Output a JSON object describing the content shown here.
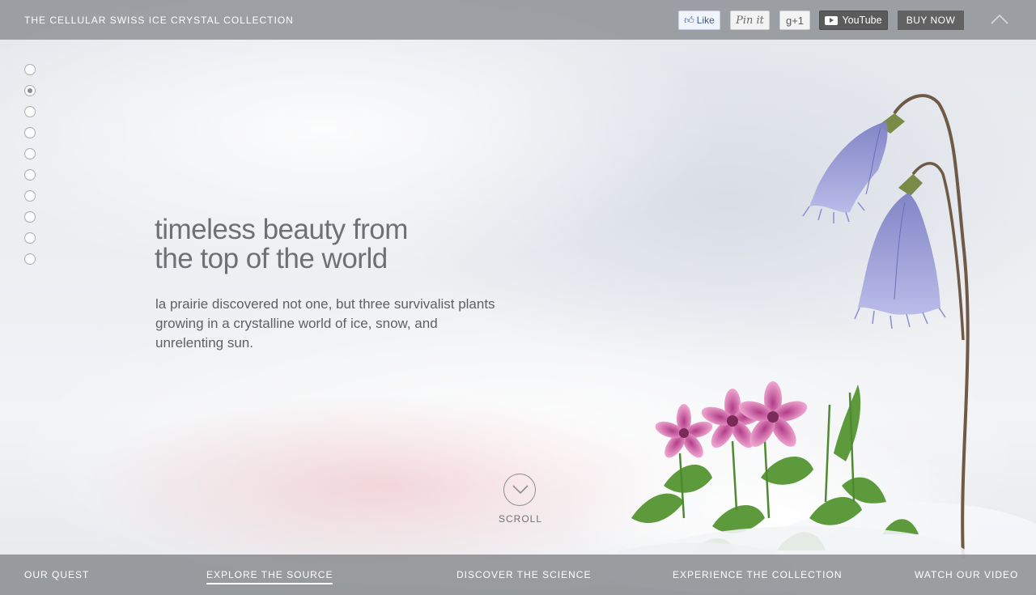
{
  "header": {
    "title": "THE CELLULAR SWISS ICE CRYSTAL COLLECTION",
    "social": {
      "like_label": "Like",
      "pin_label": "Pin it",
      "gplus_label": "g+1",
      "youtube_label": "YouTube"
    },
    "buy_label": "BUY NOW",
    "icons": {
      "like": "thumbs-up-icon",
      "youtube": "youtube-play-icon",
      "top": "chevron-up-icon"
    }
  },
  "pager": {
    "count": 10,
    "active_index": 1
  },
  "hero": {
    "headline_line1": "timeless beauty from",
    "headline_line2": "the top of the world",
    "body": "la prairie discovered not one, but three survivalist plants growing in a crystalline world of ice, snow, and unrelenting sun."
  },
  "scroll": {
    "label": "SCROLL",
    "icon": "chevron-down-circle-icon"
  },
  "bottom_nav": {
    "items": [
      {
        "label": "OUR QUEST",
        "active": false
      },
      {
        "label": "EXPLORE THE SOURCE",
        "active": true
      },
      {
        "label": "DISCOVER THE SCIENCE",
        "active": false
      },
      {
        "label": "EXPERIENCE THE COLLECTION",
        "active": false
      },
      {
        "label": "WATCH OUR VIDEO",
        "active": false
      }
    ]
  },
  "colors": {
    "bar_bg": "#878a8e",
    "text_grey": "#6d7075",
    "bell_flower": "#9b9fd6",
    "pink_flower": "#d779b3",
    "leaf_green": "#5c9a3c"
  }
}
